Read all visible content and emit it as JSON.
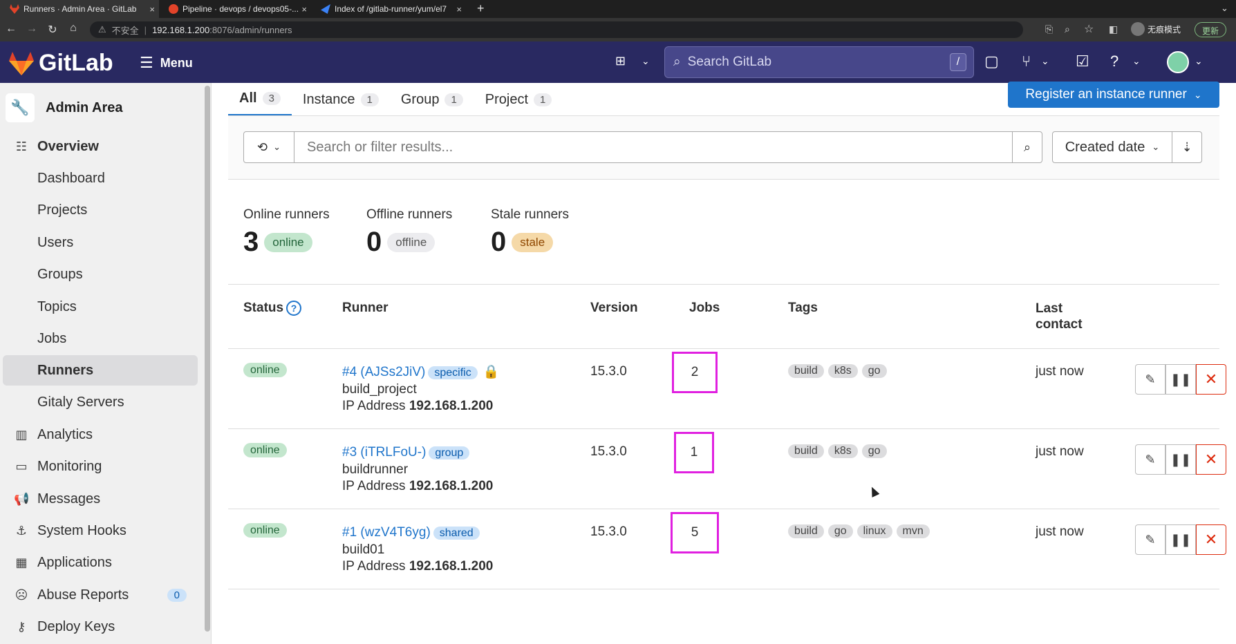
{
  "browser": {
    "tabs": [
      {
        "title": "Runners · Admin Area · GitLab"
      },
      {
        "title": "Pipeline · devops / devops05-..."
      },
      {
        "title": "Index of /gitlab-runner/yum/el7"
      }
    ],
    "url_prefix": "不安全",
    "url_host": "192.168.1.200",
    "url_path": ":8076/admin/runners",
    "incognito_label": "无痕模式",
    "update_label": "更新"
  },
  "topnav": {
    "brand": "GitLab",
    "menu_label": "Menu",
    "search_placeholder": "Search GitLab",
    "search_shortcut": "/"
  },
  "sidebar": {
    "header": "Admin Area",
    "items": [
      {
        "label": "Overview"
      },
      {
        "label": "Dashboard"
      },
      {
        "label": "Projects"
      },
      {
        "label": "Users"
      },
      {
        "label": "Groups"
      },
      {
        "label": "Topics"
      },
      {
        "label": "Jobs"
      },
      {
        "label": "Runners"
      },
      {
        "label": "Gitaly Servers"
      },
      {
        "label": "Analytics"
      },
      {
        "label": "Monitoring"
      },
      {
        "label": "Messages"
      },
      {
        "label": "System Hooks"
      },
      {
        "label": "Applications"
      },
      {
        "label": "Abuse Reports",
        "count": "0"
      },
      {
        "label": "Deploy Keys"
      }
    ]
  },
  "tabs": [
    {
      "label": "All",
      "count": "3"
    },
    {
      "label": "Instance",
      "count": "1"
    },
    {
      "label": "Group",
      "count": "1"
    },
    {
      "label": "Project",
      "count": "1"
    }
  ],
  "register_button": "Register an instance runner",
  "filter": {
    "placeholder": "Search or filter results...",
    "sort_label": "Created date"
  },
  "stats": [
    {
      "label": "Online runners",
      "value": "3",
      "badge": "online"
    },
    {
      "label": "Offline runners",
      "value": "0",
      "badge": "offline"
    },
    {
      "label": "Stale runners",
      "value": "0",
      "badge": "stale"
    }
  ],
  "table": {
    "headers": {
      "status": "Status",
      "runner": "Runner",
      "version": "Version",
      "jobs": "Jobs",
      "tags": "Tags",
      "last_contact_1": "Last",
      "last_contact_2": "contact"
    },
    "rows": [
      {
        "status": "online",
        "id": "#4 (AJSs2JiV)",
        "type": "specific",
        "description": "build_project",
        "ip_label": "IP Address",
        "ip": "192.168.1.200",
        "version": "15.3.0",
        "jobs": "2",
        "tags": [
          "build",
          "k8s",
          "go"
        ],
        "last_contact": "just now"
      },
      {
        "status": "online",
        "id": "#3 (iTRLFoU-)",
        "type": "group",
        "description": "buildrunner",
        "ip_label": "IP Address",
        "ip": "192.168.1.200",
        "version": "15.3.0",
        "jobs": "1",
        "tags": [
          "build",
          "k8s",
          "go"
        ],
        "last_contact": "just now"
      },
      {
        "status": "online",
        "id": "#1 (wzV4T6yg)",
        "type": "shared",
        "description": "build01",
        "ip_label": "IP Address",
        "ip": "192.168.1.200",
        "version": "15.3.0",
        "jobs": "5",
        "tags": [
          "build",
          "go",
          "linux",
          "mvn"
        ],
        "last_contact": "just now"
      }
    ]
  },
  "colors": {
    "nav": "#292961",
    "accent": "#1f75cb",
    "highlight": "#e020e0",
    "danger": "#dd2b0e"
  }
}
